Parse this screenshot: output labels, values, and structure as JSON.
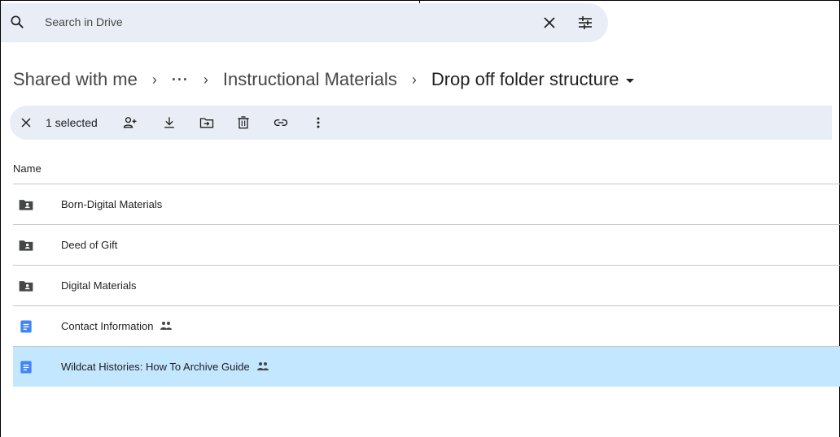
{
  "search": {
    "placeholder": "Search in Drive",
    "clear_icon": "close-icon",
    "filter_icon": "tune-icon"
  },
  "breadcrumb": {
    "root": "Shared with me",
    "separator": "›",
    "overflow": "···",
    "parent": "Instructional Materials",
    "current": "Drop off folder structure"
  },
  "selection_toolbar": {
    "count_label": "1 selected",
    "actions": [
      "close-icon",
      "share-icon",
      "download-icon",
      "move-icon",
      "trash-icon",
      "link-icon",
      "more-icon"
    ]
  },
  "list": {
    "column_header": "Name",
    "items": [
      {
        "name": "Born-Digital Materials",
        "type": "shared-folder",
        "shared": false,
        "selected": false
      },
      {
        "name": "Deed of Gift",
        "type": "shared-folder",
        "shared": false,
        "selected": false
      },
      {
        "name": "Digital Materials",
        "type": "shared-folder",
        "shared": false,
        "selected": false
      },
      {
        "name": "Contact Information",
        "type": "google-doc",
        "shared": true,
        "selected": false
      },
      {
        "name": "Wildcat Histories: How To Archive Guide",
        "type": "google-doc",
        "shared": true,
        "selected": true
      }
    ]
  },
  "colors": {
    "search_bg": "#e9eef6",
    "selected_row_bg": "#c2e7ff",
    "doc_blue": "#4285f4",
    "folder_dark": "#444746"
  }
}
